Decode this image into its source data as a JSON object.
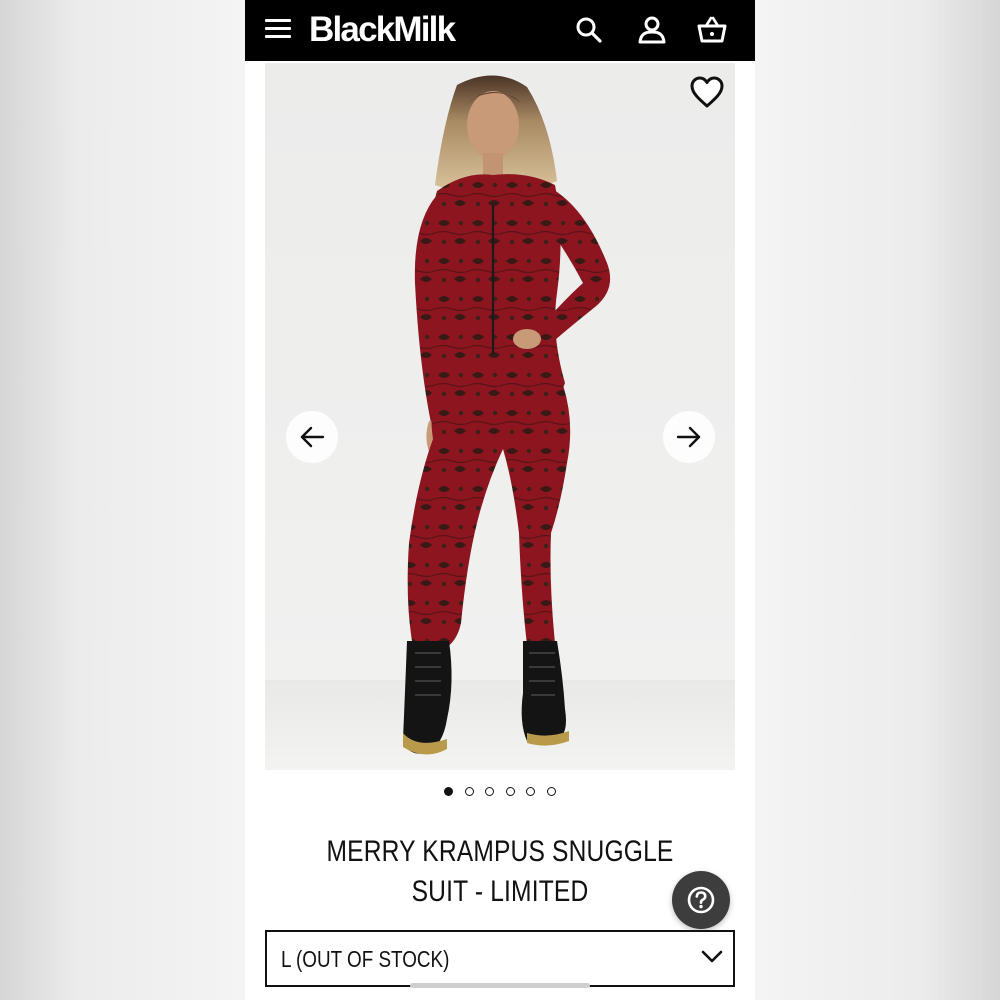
{
  "header": {
    "brand": "BlackMilk",
    "menu_icon": "hamburger-menu-icon",
    "search_icon": "search-icon",
    "account_icon": "user-icon",
    "cart_icon": "basket-icon",
    "background": "#000000"
  },
  "gallery": {
    "wishlist_icon": "heart-icon",
    "prev_icon": "arrow-left-icon",
    "next_icon": "arrow-right-icon",
    "slide_count": 6,
    "active_slide": 1
  },
  "product": {
    "title": "MERRY KRAMPUS SNUGGLE SUIT - LIMITED",
    "suit_color": "#8c1520"
  },
  "size_selector": {
    "selected": "L (OUT OF STOCK)",
    "icon": "chevron-down-icon"
  },
  "help_button": {
    "icon": "question-mark-icon"
  }
}
